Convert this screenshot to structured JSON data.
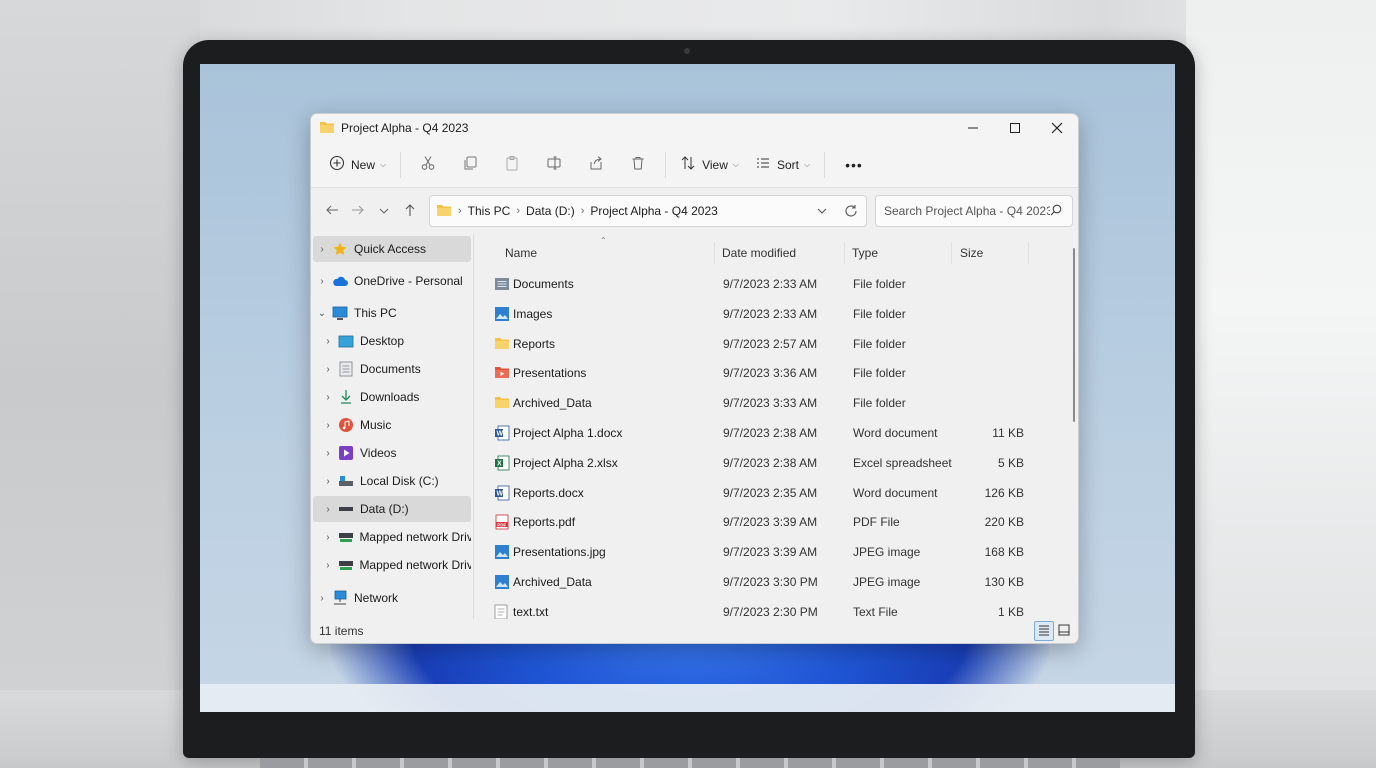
{
  "window": {
    "title": "Project Alpha - Q4 2023"
  },
  "toolbar": {
    "new_label": "New",
    "view_label": "View",
    "sort_label": "Sort",
    "more_label": "•••"
  },
  "address": {
    "crumbs": [
      "This PC",
      "Data (D:)",
      "Project Alpha - Q4 2023"
    ]
  },
  "search": {
    "placeholder": "Search Project Alpha - Q4 2023"
  },
  "nav": {
    "quick_access": "Quick Access",
    "onedrive": "OneDrive - Personal",
    "this_pc": "This PC",
    "desktop": "Desktop",
    "documents": "Documents",
    "downloads": "Downloads",
    "music": "Music",
    "videos": "Videos",
    "local_disk": "Local Disk (C:)",
    "data_d": "Data (D:)",
    "mapped1": "Mapped network Driv",
    "mapped2": "Mapped network Driv",
    "network": "Network"
  },
  "columns": {
    "name": "Name",
    "date": "Date modified",
    "type": "Type",
    "size": "Size"
  },
  "files": [
    {
      "name": "Documents",
      "date": "9/7/2023 2:33 AM",
      "type": "File folder",
      "size": "",
      "icon": "documents-folder"
    },
    {
      "name": "Images",
      "date": "9/7/2023 2:33 AM",
      "type": "File folder",
      "size": "",
      "icon": "images-folder"
    },
    {
      "name": "Reports",
      "date": "9/7/2023 2:57 AM",
      "type": "File folder",
      "size": "",
      "icon": "folder"
    },
    {
      "name": "Presentations",
      "date": "9/7/2023 3:36 AM",
      "type": "File folder",
      "size": "",
      "icon": "presentations-folder"
    },
    {
      "name": "Archived_Data",
      "date": "9/7/2023 3:33 AM",
      "type": "File folder",
      "size": "",
      "icon": "folder"
    },
    {
      "name": "Project Alpha 1.docx",
      "date": "9/7/2023 2:38 AM",
      "type": "Word document",
      "size": "11 KB",
      "icon": "word"
    },
    {
      "name": "Project Alpha 2.xlsx",
      "date": "9/7/2023 2:38 AM",
      "type": "Excel spreadsheet",
      "size": "5 KB",
      "icon": "excel"
    },
    {
      "name": "Reports.docx",
      "date": "9/7/2023 2:35 AM",
      "type": "Word document",
      "size": "126 KB",
      "icon": "word"
    },
    {
      "name": "Reports.pdf",
      "date": "9/7/2023 3:39 AM",
      "type": "PDF File",
      "size": "220 KB",
      "icon": "pdf"
    },
    {
      "name": "Presentations.jpg",
      "date": "9/7/2023 3:39 AM",
      "type": "JPEG image",
      "size": "168 KB",
      "icon": "image"
    },
    {
      "name": "Archived_Data",
      "date": "9/7/2023 3:30 PM",
      "type": "JPEG image",
      "size": "130 KB",
      "icon": "image"
    },
    {
      "name": "text.txt",
      "date": "9/7/2023 2:30 PM",
      "type": "Text File",
      "size": "1 KB",
      "icon": "text"
    }
  ],
  "status": {
    "count": "11 items"
  }
}
